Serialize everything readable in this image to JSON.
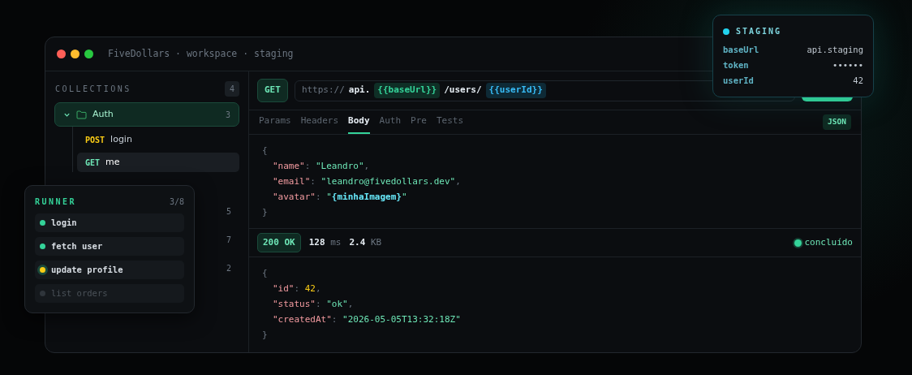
{
  "window": {
    "title": "FiveDollars · workspace · staging"
  },
  "sidebar": {
    "title": "COLLECTIONS",
    "count": "4",
    "items": [
      {
        "kind": "folder",
        "name": "Auth",
        "count": "3",
        "expanded": true,
        "children": [
          {
            "kind": "request",
            "method": "POST",
            "name": "login",
            "selected": false
          },
          {
            "kind": "request",
            "method": "GET",
            "name": "me",
            "selected": true
          }
        ]
      },
      {
        "kind": "hidden"
      },
      {
        "kind": "folder",
        "count": "5",
        "expanded": false
      },
      {
        "kind": "folder",
        "count": "7",
        "expanded": false
      },
      {
        "kind": "folder",
        "count": "2",
        "expanded": false
      }
    ]
  },
  "request": {
    "method": "GET",
    "url": [
      {
        "kind": "scheme",
        "text": "https://"
      },
      {
        "kind": "text",
        "text": "api."
      },
      {
        "kind": "var",
        "text": "{{baseUrl}}"
      },
      {
        "kind": "text",
        "text": "/users/"
      },
      {
        "kind": "pathvar",
        "text": "{{userId}}"
      }
    ],
    "tabs": [
      {
        "label": "Params",
        "selected": false
      },
      {
        "label": "Headers",
        "selected": false
      },
      {
        "label": "Body",
        "selected": true
      },
      {
        "label": "Auth",
        "selected": false
      },
      {
        "label": "Pre",
        "selected": false
      },
      {
        "label": "Tests",
        "selected": false
      }
    ],
    "format": "JSON",
    "body": [
      [
        {
          "kind": "punct",
          "text": "{"
        }
      ],
      [
        {
          "kind": "key",
          "text": "\"name\""
        },
        {
          "kind": "punct",
          "text": ": "
        },
        {
          "kind": "str",
          "text": "\"Leandro\""
        },
        {
          "kind": "punct",
          "text": ","
        }
      ],
      [
        {
          "kind": "key",
          "text": "\"email\""
        },
        {
          "kind": "punct",
          "text": ": "
        },
        {
          "kind": "str",
          "text": "\"leandro@fivedollars.dev\""
        },
        {
          "kind": "punct",
          "text": ","
        }
      ],
      [
        {
          "kind": "key",
          "text": "\"avatar\""
        },
        {
          "kind": "punct",
          "text": ": "
        },
        {
          "kind": "str",
          "text": "\""
        },
        {
          "kind": "var",
          "text": "{minhaImagem}"
        },
        {
          "kind": "str",
          "text": "\""
        }
      ],
      [
        {
          "kind": "punct",
          "text": "}"
        }
      ]
    ]
  },
  "response": {
    "status": "200 OK",
    "time": "128",
    "time_unit": "ms",
    "size": "2.4",
    "size_unit": "KB",
    "state": "concluído",
    "body": [
      [
        {
          "kind": "punct",
          "text": "{"
        }
      ],
      [
        {
          "kind": "key",
          "text": "\"id\""
        },
        {
          "kind": "punct",
          "text": ": "
        },
        {
          "kind": "num",
          "text": "42"
        },
        {
          "kind": "punct",
          "text": ","
        }
      ],
      [
        {
          "kind": "key",
          "text": "\"status\""
        },
        {
          "kind": "punct",
          "text": ": "
        },
        {
          "kind": "str",
          "text": "\"ok\""
        },
        {
          "kind": "punct",
          "text": ","
        }
      ],
      [
        {
          "kind": "key",
          "text": "\"createdAt\""
        },
        {
          "kind": "punct",
          "text": ": "
        },
        {
          "kind": "str",
          "text": "\"2026-05-05T13:32:18Z\""
        }
      ],
      [
        {
          "kind": "punct",
          "text": "}"
        }
      ]
    ]
  },
  "environment": {
    "name": "STAGING",
    "color": "#22d3ee",
    "vars": [
      {
        "key": "baseUrl",
        "value": "api.staging"
      },
      {
        "key": "token",
        "value": "••••••"
      },
      {
        "key": "userId",
        "value": "42"
      }
    ]
  },
  "runner": {
    "title": "RUNNER",
    "progress": "3/8",
    "steps": [
      {
        "name": "login",
        "kind": "done"
      },
      {
        "name": "fetch user",
        "kind": "done"
      },
      {
        "name": "update profile",
        "kind": "running"
      },
      {
        "name": "list orders",
        "kind": "pending"
      }
    ]
  }
}
